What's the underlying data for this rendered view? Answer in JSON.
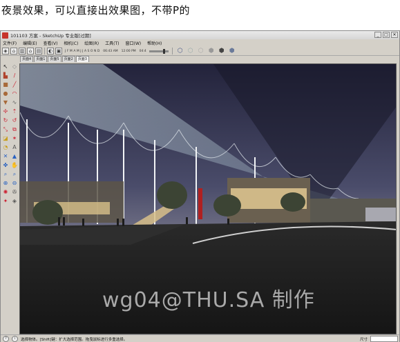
{
  "caption": "夜景效果，可以直接出效果图，不带P的",
  "window": {
    "title": "101103 方案 - SketchUp 专业版[过期]",
    "controls": [
      "_",
      "□",
      "✕"
    ]
  },
  "menu": [
    "文件(F)",
    "编辑(E)",
    "查看(V)",
    "相机(C)",
    "绘图(R)",
    "工具(T)",
    "窗口(W)",
    "帮助(H)"
  ],
  "toolbar": {
    "months": [
      "J",
      "F",
      "M",
      "A",
      "M",
      "J",
      "J",
      "A",
      "S",
      "O",
      "N",
      "D"
    ],
    "time_start": "06:43 AM",
    "time_noon": "12:00 PM",
    "time_end": "04:4"
  },
  "page_tabs": [
    "页面4",
    "页面1",
    "页面5",
    "页面2",
    "页面3"
  ],
  "active_tab_index": 4,
  "tools": [
    {
      "icon": "select-icon",
      "glyph": "↖",
      "color": "#222"
    },
    {
      "icon": "eraser-icon",
      "glyph": "◇",
      "color": "#888"
    },
    {
      "icon": "paint-bucket-icon",
      "glyph": "▙",
      "color": "#b0422c"
    },
    {
      "icon": "pencil-icon",
      "glyph": "/",
      "color": "#c23"
    },
    {
      "icon": "rectangle-icon",
      "glyph": "■",
      "color": "#a86a3a"
    },
    {
      "icon": "line-icon",
      "glyph": "╱",
      "color": "#c23"
    },
    {
      "icon": "circle-icon",
      "glyph": "●",
      "color": "#a86a3a"
    },
    {
      "icon": "arc-icon",
      "glyph": "◠",
      "color": "#c23"
    },
    {
      "icon": "polygon-icon",
      "glyph": "▼",
      "color": "#a86a3a"
    },
    {
      "icon": "freehand-icon",
      "glyph": "∿",
      "color": "#666"
    },
    {
      "icon": "move-icon",
      "glyph": "✢",
      "color": "#c23"
    },
    {
      "icon": "push-pull-icon",
      "glyph": "⇡",
      "color": "#c23"
    },
    {
      "icon": "rotate-icon",
      "glyph": "↻",
      "color": "#c23"
    },
    {
      "icon": "follow-me-icon",
      "glyph": "↺",
      "color": "#c23"
    },
    {
      "icon": "scale-icon",
      "glyph": "⤡",
      "color": "#c23"
    },
    {
      "icon": "offset-icon",
      "glyph": "⧉",
      "color": "#c23"
    },
    {
      "icon": "tape-measure-icon",
      "glyph": "◪",
      "color": "#c8a020"
    },
    {
      "icon": "dimension-icon",
      "glyph": "✶",
      "color": "#c23"
    },
    {
      "icon": "protractor-icon",
      "glyph": "◔",
      "color": "#c8a020"
    },
    {
      "icon": "text-icon",
      "glyph": "A",
      "color": "#555"
    },
    {
      "icon": "axes-icon",
      "glyph": "✕",
      "color": "#2a62c0"
    },
    {
      "icon": "3d-text-icon",
      "glyph": "▲",
      "color": "#2a62c0"
    },
    {
      "icon": "orbit-icon",
      "glyph": "✤",
      "color": "#2a62c0"
    },
    {
      "icon": "pan-icon",
      "glyph": "✋",
      "color": "#2a62c0"
    },
    {
      "icon": "zoom-icon",
      "glyph": "⌕",
      "color": "#2a62c0"
    },
    {
      "icon": "zoom-window-icon",
      "glyph": "⌕",
      "color": "#2a62c0"
    },
    {
      "icon": "zoom-extents-icon",
      "glyph": "⊕",
      "color": "#2a62c0"
    },
    {
      "icon": "previous-view-icon",
      "glyph": "⊖",
      "color": "#2a62c0"
    },
    {
      "icon": "position-camera-icon",
      "glyph": "✺",
      "color": "#c23"
    },
    {
      "icon": "walk-icon",
      "glyph": "✇",
      "color": "#555"
    },
    {
      "icon": "look-around-icon",
      "glyph": "✦",
      "color": "#c23"
    },
    {
      "icon": "section-plane-icon",
      "glyph": "◈",
      "color": "#555"
    }
  ],
  "status": {
    "text": "选择物体。[Shift]键：扩大选择范围。拖曳鼠标进行多重选择。",
    "dimension_label": "尺寸"
  },
  "watermark": "wg04@THU.SA 制作"
}
